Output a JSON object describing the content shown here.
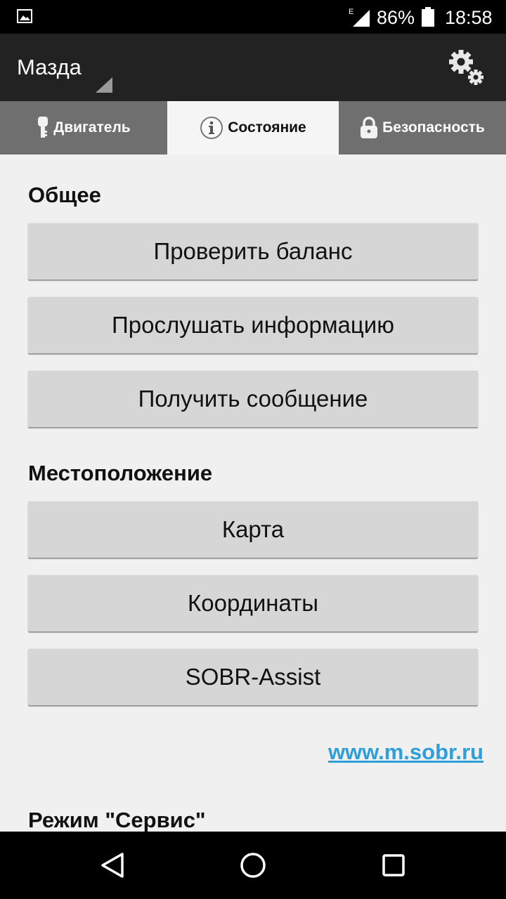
{
  "status_bar": {
    "network_type": "E",
    "battery_percent": "86%",
    "time": "18:58"
  },
  "app_bar": {
    "title": "Мазда",
    "settings_icon": "gear-icon"
  },
  "tabs": [
    {
      "label": "Двигатель",
      "icon": "key-icon",
      "active": false
    },
    {
      "label": "Состояние",
      "icon": "info-icon",
      "active": true
    },
    {
      "label": "Безопасность",
      "icon": "lock-icon",
      "active": false
    }
  ],
  "sections": {
    "general": {
      "title": "Общее",
      "buttons": [
        "Проверить баланс",
        "Прослушать информацию",
        "Получить сообщение"
      ]
    },
    "location": {
      "title": "Местоположение",
      "buttons": [
        "Карта",
        "Координаты",
        "SOBR-Assist"
      ]
    },
    "service": {
      "title": "Режим \"Сервис\""
    }
  },
  "link": "www.m.sobr.ru",
  "colors": {
    "link": "#2e9fd9",
    "app_bar": "#222222",
    "tab_bar": "#6f6f6f",
    "button": "#d6d6d6"
  }
}
